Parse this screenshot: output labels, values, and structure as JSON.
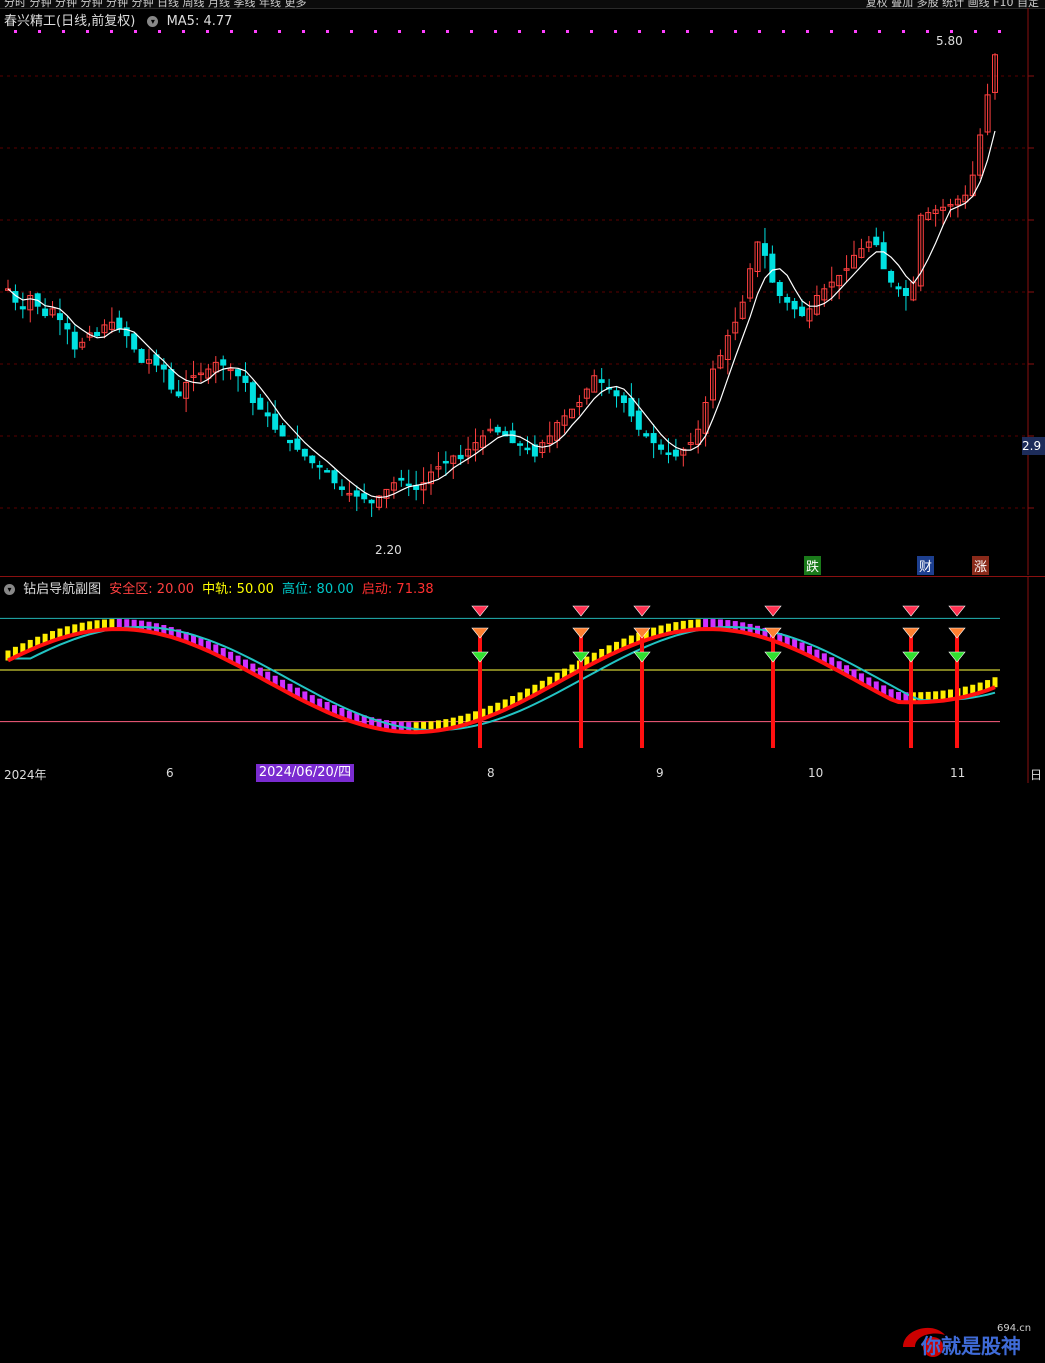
{
  "toolbar": {
    "left_label": "分时 分钟 分钟 分钟 分钟 分钟 日线 周线 月线 季线 年线 更多",
    "right_label": "复权 叠加 多股 统计 画线 F10 自定"
  },
  "main": {
    "title": "春兴精工(日线,前复权)",
    "ma_label": "MA5: 4.77",
    "high_label": "5.80",
    "low_label": "2.20",
    "price_tag": "2.9",
    "badges": [
      {
        "text": "跌",
        "color": "#1a7a1a"
      },
      {
        "text": "财",
        "color": "#1d3f8f"
      },
      {
        "text": "涨",
        "color": "#8a2a1a"
      }
    ]
  },
  "sub": {
    "title": "钻启导航副图",
    "safe_label": "安全区: 20.00",
    "mid_label": "中轨: 50.00",
    "high_label": "高位: 80.00",
    "start_label": "启动: 71.38",
    "colors": {
      "safe": "#ff4040",
      "mid": "#ffff00",
      "high": "#00c8c8",
      "start": "#ff3030"
    }
  },
  "xaxis": {
    "labels": [
      "2024年",
      "6",
      "8",
      "9",
      "10",
      "11",
      "日"
    ],
    "cursor_date": "2024/06/20/四"
  },
  "watermark": {
    "text": "你就是股神",
    "domain": "694.cn"
  },
  "chart_data": {
    "type": "candlestick",
    "series": [
      {
        "name": "春兴精工",
        "closes": [
          4.05,
          3.95,
          3.9,
          4.0,
          3.92,
          3.85,
          3.9,
          3.82,
          3.75,
          3.6,
          3.65,
          3.72,
          3.7,
          3.78,
          3.8,
          3.75,
          3.7,
          3.6,
          3.5,
          3.52,
          3.48,
          3.45,
          3.3,
          3.25,
          3.35,
          3.4,
          3.42,
          3.45,
          3.5,
          3.48,
          3.45,
          3.4,
          3.35,
          3.2,
          3.15,
          3.1,
          3.0,
          2.95,
          2.9,
          2.85,
          2.8,
          2.75,
          2.72,
          2.68,
          2.6,
          2.55,
          2.52,
          2.5,
          2.48,
          2.45,
          2.5,
          2.55,
          2.6,
          2.62,
          2.58,
          2.55,
          2.6,
          2.68,
          2.72,
          2.75,
          2.8,
          2.78,
          2.85,
          2.9,
          2.95,
          3.0,
          2.98,
          2.95,
          2.9,
          2.88,
          2.85,
          2.8,
          2.9,
          2.95,
          3.05,
          3.1,
          3.15,
          3.2,
          3.3,
          3.4,
          3.35,
          3.3,
          3.25,
          3.2,
          3.1,
          3.0,
          2.95,
          2.9,
          2.85,
          2.82,
          2.8,
          2.85,
          2.9,
          3.0,
          3.2,
          3.45,
          3.55,
          3.7,
          3.8,
          3.95,
          4.2,
          4.4,
          4.3,
          4.1,
          4.0,
          3.95,
          3.9,
          3.85,
          3.9,
          4.0,
          4.05,
          4.1,
          4.15,
          4.2,
          4.3,
          4.35,
          4.4,
          4.38,
          4.2,
          4.1,
          4.05,
          4.0,
          4.1,
          4.6,
          4.62,
          4.64,
          4.66,
          4.68,
          4.72,
          4.75,
          4.9,
          5.2,
          5.5,
          5.8
        ]
      }
    ],
    "ma5": {
      "name": "MA5",
      "last": 4.77
    },
    "price_high": 5.8,
    "price_low": 2.2,
    "oscillator": {
      "name": "钻启导航副图",
      "levels": {
        "安全区": 20.0,
        "中轨": 50.0,
        "高位": 80.0
      },
      "last": 71.38,
      "signal_columns": [
        480,
        581,
        642,
        773,
        911,
        957
      ]
    }
  }
}
